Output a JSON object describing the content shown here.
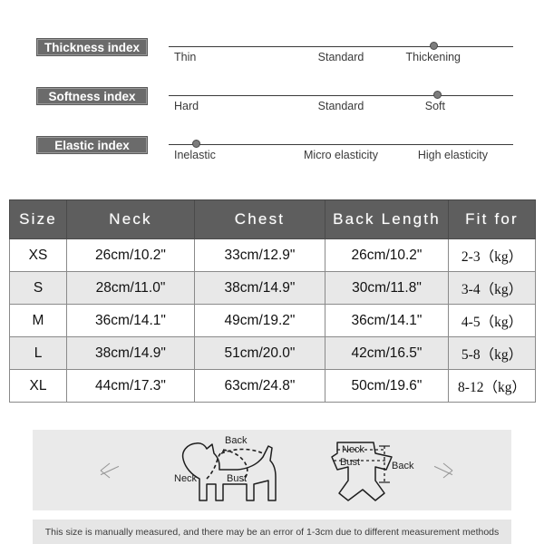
{
  "indices": [
    {
      "badge": "Thickness index",
      "labels": [
        "Thin",
        "Standard",
        "Thickening"
      ],
      "marker_percent": 77,
      "selected": "Thickening"
    },
    {
      "badge": "Softness index",
      "labels": [
        "Hard",
        "Standard",
        "Soft"
      ],
      "marker_percent": 78,
      "selected": "Soft"
    },
    {
      "badge": "Elastic index",
      "labels": [
        "Inelastic",
        "Micro elasticity",
        "High elasticity"
      ],
      "marker_percent": 8,
      "selected": "Inelastic"
    }
  ],
  "table": {
    "headers": [
      "Size",
      "Neck",
      "Chest",
      "Back Length",
      "Fit for"
    ],
    "rows": [
      {
        "size": "XS",
        "neck": "26cm/10.2\"",
        "chest": "33cm/12.9\"",
        "back": "26cm/10.2\"",
        "fit": "2-3（kg）"
      },
      {
        "size": "S",
        "neck": "28cm/11.0\"",
        "chest": "38cm/14.9\"",
        "back": "30cm/11.8\"",
        "fit": "3-4（kg）"
      },
      {
        "size": "M",
        "neck": "36cm/14.1\"",
        "chest": "49cm/19.2\"",
        "back": "36cm/14.1\"",
        "fit": "4-5（kg）"
      },
      {
        "size": "L",
        "neck": "38cm/14.9\"",
        "chest": "51cm/20.0\"",
        "back": "42cm/16.5\"",
        "fit": "5-8（kg）"
      },
      {
        "size": "XL",
        "neck": "44cm/17.3\"",
        "chest": "63cm/24.8\"",
        "back": "50cm/19.6\"",
        "fit": "8-12（kg）"
      }
    ]
  },
  "diagram": {
    "dog_labels": {
      "back": "Back",
      "neck": "Neck",
      "bust": "Bust"
    },
    "shirt_labels": {
      "neck": "Neck",
      "bust": "Bust",
      "back": "Back"
    },
    "prev_icon": "arrow-left-icon",
    "next_icon": "arrow-right-icon"
  },
  "footer": {
    "note": "This size is manually measured, and there may be an error of 1-3cm due to different measurement methods"
  },
  "colors": {
    "badge_bg": "#6b6b6b",
    "header_bg": "#5e5e5e",
    "stripe_bg": "#e8e8e8",
    "panel_bg": "#eaeaea",
    "marker": "#7d7d7d"
  }
}
